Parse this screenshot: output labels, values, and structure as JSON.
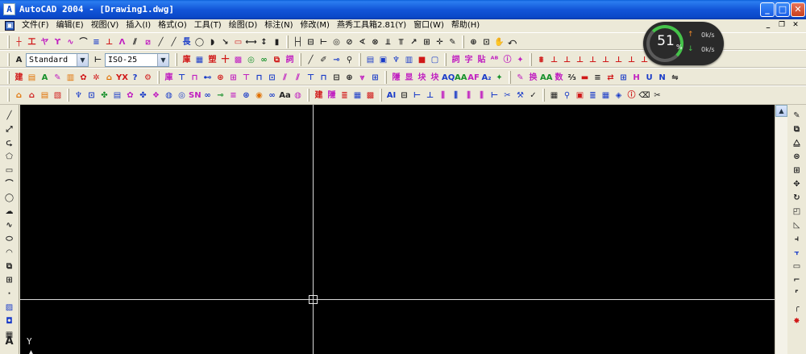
{
  "window": {
    "app_icon": "A",
    "title": "AutoCAD 2004 - [Drawing1.dwg]",
    "buttons": {
      "minimize": "_",
      "maximize": "□",
      "close": "✕"
    }
  },
  "menubar": {
    "items": [
      "文件(F)",
      "编辑(E)",
      "视图(V)",
      "插入(I)",
      "格式(O)",
      "工具(T)",
      "绘图(D)",
      "标注(N)",
      "修改(M)",
      "燕秀工具箱2.81(Y)",
      "窗口(W)",
      "帮助(H)"
    ],
    "mdi": {
      "minimize": "_",
      "restore": "❐",
      "close": "✕"
    }
  },
  "toolbar2": {
    "text_style": "Standard",
    "dim_style": "ISO-25"
  },
  "canvas": {
    "ucs_y": "Y",
    "ucs_tick": "▲"
  },
  "netmon": {
    "percent": "51",
    "percent_sign": "%",
    "upload": "0k/s",
    "download": "0k/s",
    "up_arrow": "↑",
    "down_arrow": "↓"
  },
  "colors": {
    "titlebar": "#0a48c8",
    "canvas": "#000000",
    "crosshair": "#d8d8d8",
    "toolbar_bg": "#ece9d8"
  }
}
